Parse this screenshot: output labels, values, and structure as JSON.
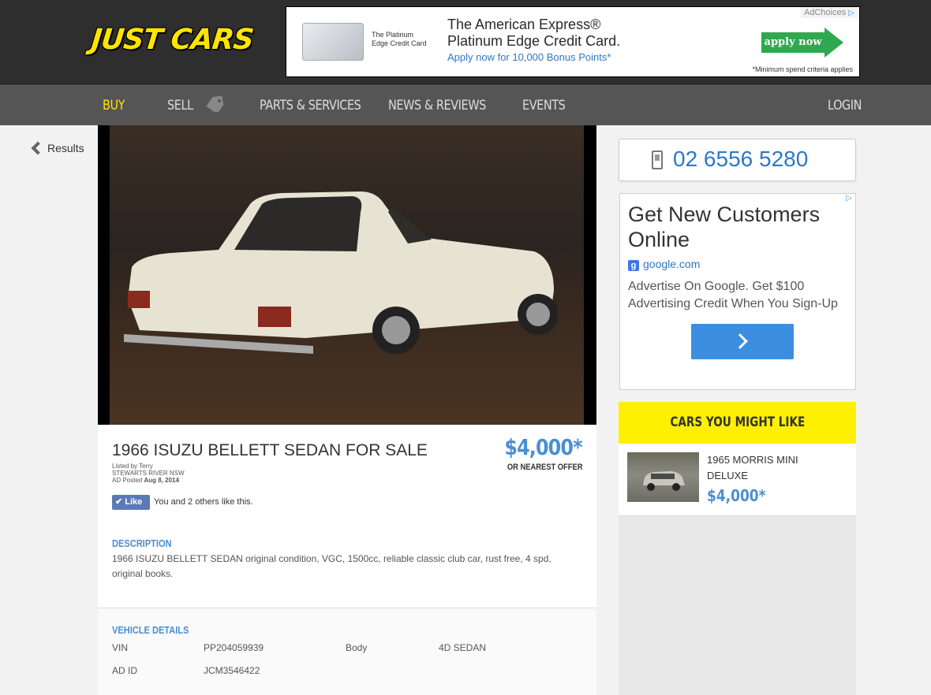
{
  "brand": {
    "logo_text": "JUST CARS",
    "accent": "#ffe400",
    "link_blue": "#4a8fd1"
  },
  "banner_ad": {
    "adchoices": "AdChoices",
    "card_label": "The Platinum Edge Credit Card",
    "title_line1": "The American Express®",
    "title_line2": "Platinum Edge Credit Card.",
    "subtitle": "Apply now for 10,000 Bonus Points*",
    "button": "apply now",
    "fineprint": "*Minimum spend criteria applies"
  },
  "nav": {
    "buy": "BUY",
    "sell": "SELL",
    "parts": "PARTS & SERVICES",
    "news": "NEWS & REVIEWS",
    "events": "EVENTS",
    "login": "LOGIN"
  },
  "back": {
    "label": "Results"
  },
  "listing": {
    "title": "1966 ISUZU BELLETT SEDAN FOR SALE",
    "listed_by": "Listed by Terry",
    "location": "STEWARTS RIVER NSW",
    "posted_label": "AD Posted",
    "posted_date": "Aug 8, 2014",
    "price": "$4,000*",
    "price_note": "OR NEAREST OFFER",
    "like_button": "Like",
    "like_text": "You and 2 others like this.",
    "description_title": "DESCRIPTION",
    "description_line1": "1966 ISUZU BELLETT SEDAN original condition, VGC, 1500cc, reliable classic club car, rust free, 4 spd,",
    "description_line2": "original books.",
    "details_title": "VEHICLE DETAILS",
    "details": {
      "vin_label": "VIN",
      "vin_value": "PP204059939",
      "body_label": "Body",
      "body_value": "4D SEDAN",
      "adid_label": "AD ID",
      "adid_value": "JCM3546422"
    }
  },
  "sidebar": {
    "phone": "02 6556 5280",
    "google_ad": {
      "title": "Get New Customers Online",
      "url": "google.com",
      "body": "Advertise On Google. Get $100 Advertising Credit When You Sign-Up"
    },
    "might_like": {
      "heading": "CARS YOU MIGHT LIKE",
      "items": [
        {
          "title": "1965 MORRIS MINI DELUXE",
          "price": "$4,000*"
        }
      ]
    }
  }
}
